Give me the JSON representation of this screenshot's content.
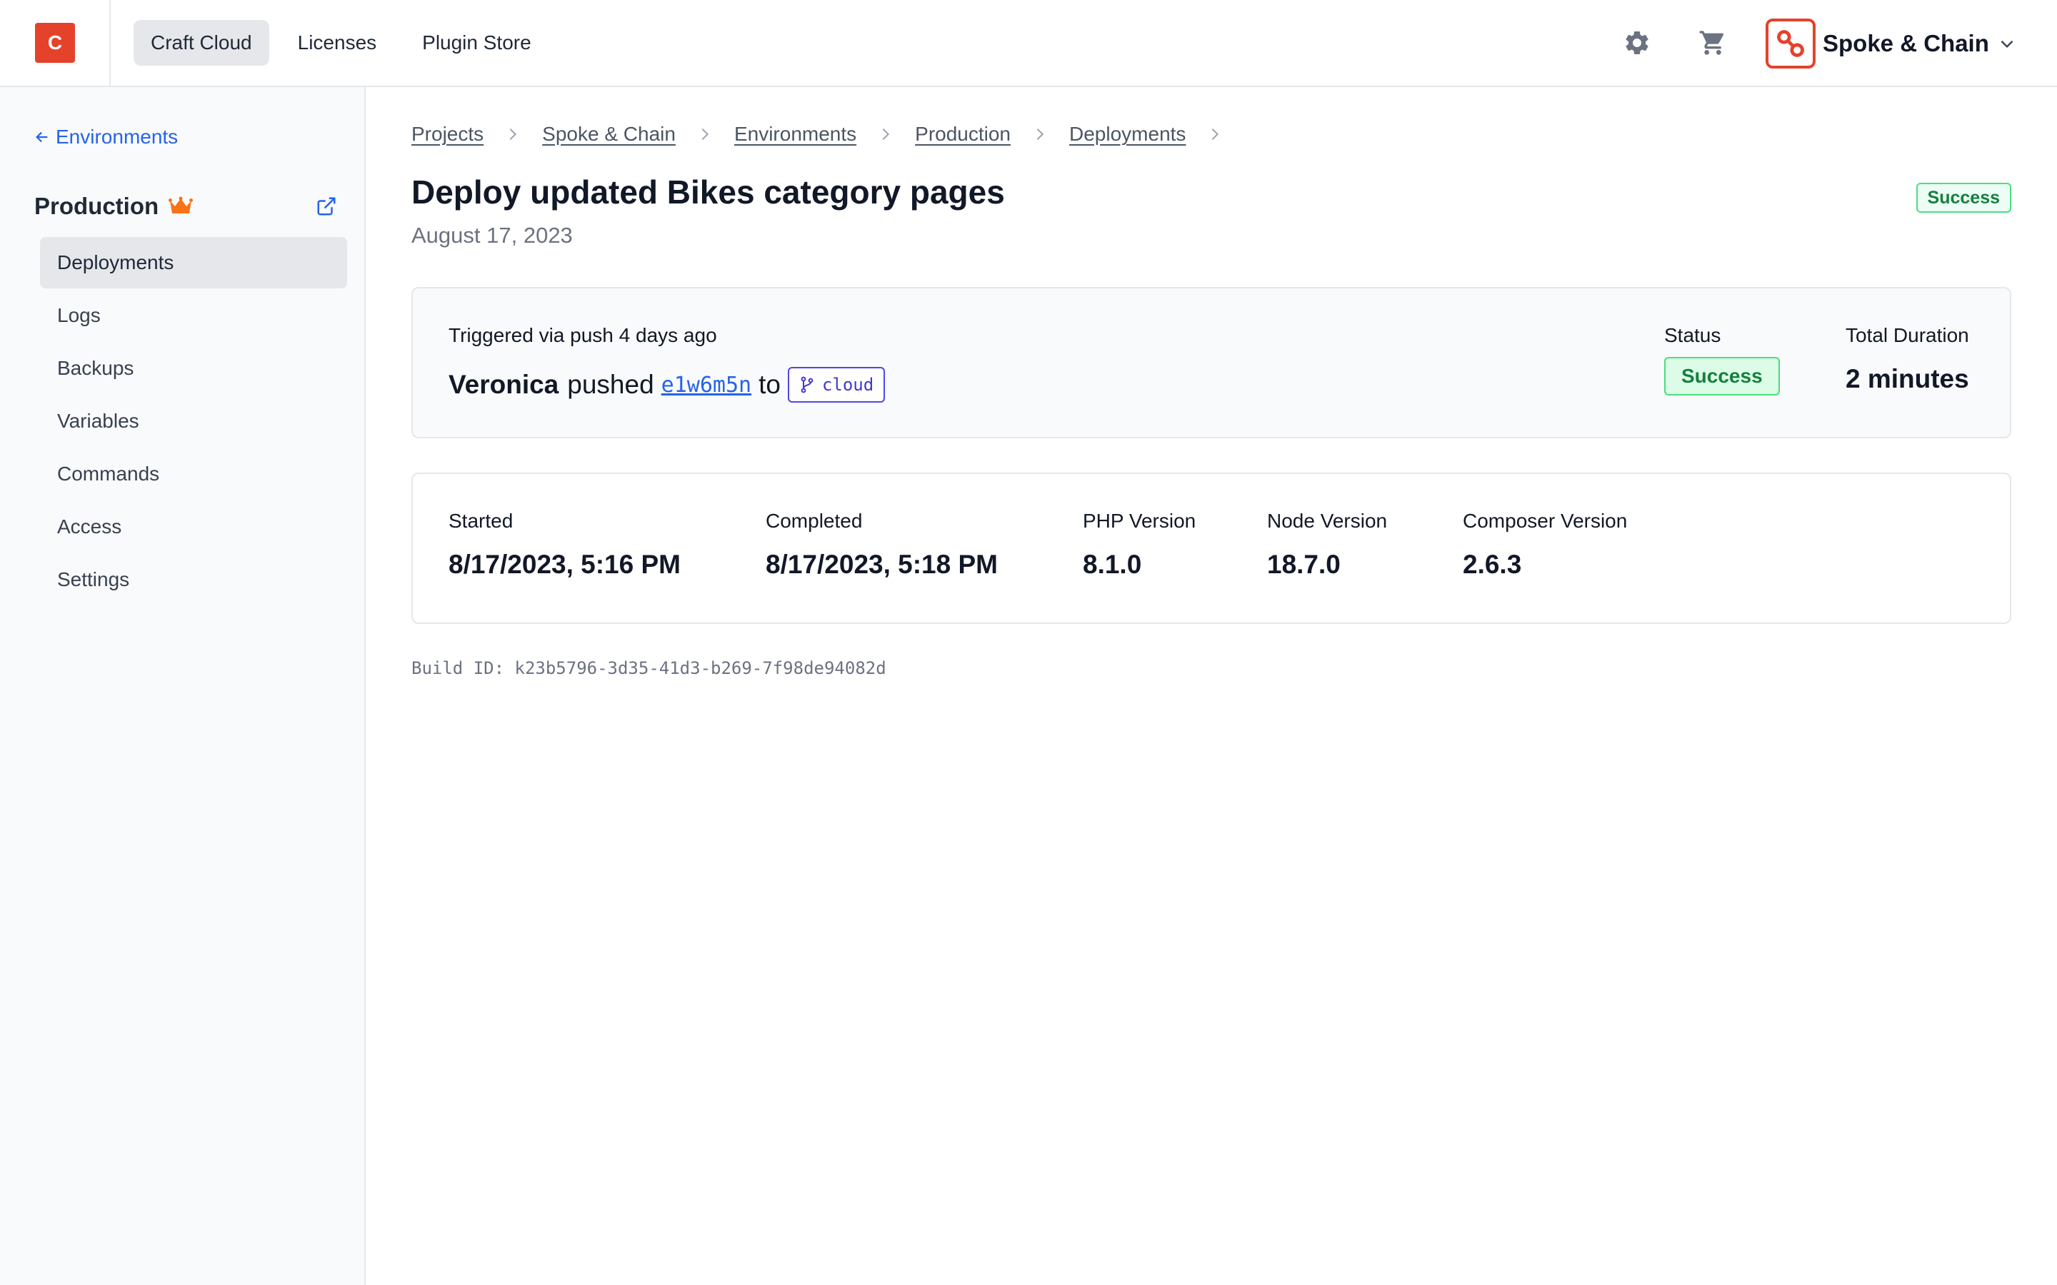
{
  "app": {
    "logo_letter": "C",
    "nav": [
      {
        "label": "Craft Cloud",
        "active": true
      },
      {
        "label": "Licenses",
        "active": false
      },
      {
        "label": "Plugin Store",
        "active": false
      }
    ],
    "icons": [
      "gear-icon",
      "cart-icon"
    ],
    "org": {
      "name": "Spoke & Chain",
      "avatar_icon": "chain-link-icon"
    }
  },
  "sidebar": {
    "back_label": "Environments",
    "env_title": "Production",
    "env_badge_icon": "crown-icon",
    "items": [
      {
        "label": "Deployments",
        "active": true
      },
      {
        "label": "Logs",
        "active": false
      },
      {
        "label": "Backups",
        "active": false
      },
      {
        "label": "Variables",
        "active": false
      },
      {
        "label": "Commands",
        "active": false
      },
      {
        "label": "Access",
        "active": false
      },
      {
        "label": "Settings",
        "active": false
      }
    ]
  },
  "breadcrumb": [
    "Projects",
    "Spoke & Chain",
    "Environments",
    "Production",
    "Deployments"
  ],
  "deployment": {
    "title": "Deploy updated Bikes category pages",
    "date": "August 17, 2023",
    "status_badge": "Success",
    "trigger_text": "Triggered via push 4 days ago",
    "user": "Veronica",
    "pushed_word": "pushed",
    "commit": "e1w6m5n",
    "to_word": "to",
    "branch": "cloud",
    "status_label": "Status",
    "status_value": "Success",
    "duration_label": "Total Duration",
    "duration_value": "2 minutes"
  },
  "details": [
    {
      "label": "Started",
      "value": "8/17/2023, 5:16 PM"
    },
    {
      "label": "Completed",
      "value": "8/17/2023, 5:18 PM"
    },
    {
      "label": "PHP Version",
      "value": "8.1.0"
    },
    {
      "label": "Node Version",
      "value": "18.7.0"
    },
    {
      "label": "Composer Version",
      "value": "2.6.3"
    }
  ],
  "build_id": "Build ID: k23b5796-3d35-41d3-b269-7f98de94082d",
  "colors": {
    "brand": "#e5422b",
    "link": "#2563eb",
    "success_text": "#15803d",
    "success_bg": "#dcfce7",
    "success_border": "#4ade80",
    "branch": "#4338ca"
  }
}
